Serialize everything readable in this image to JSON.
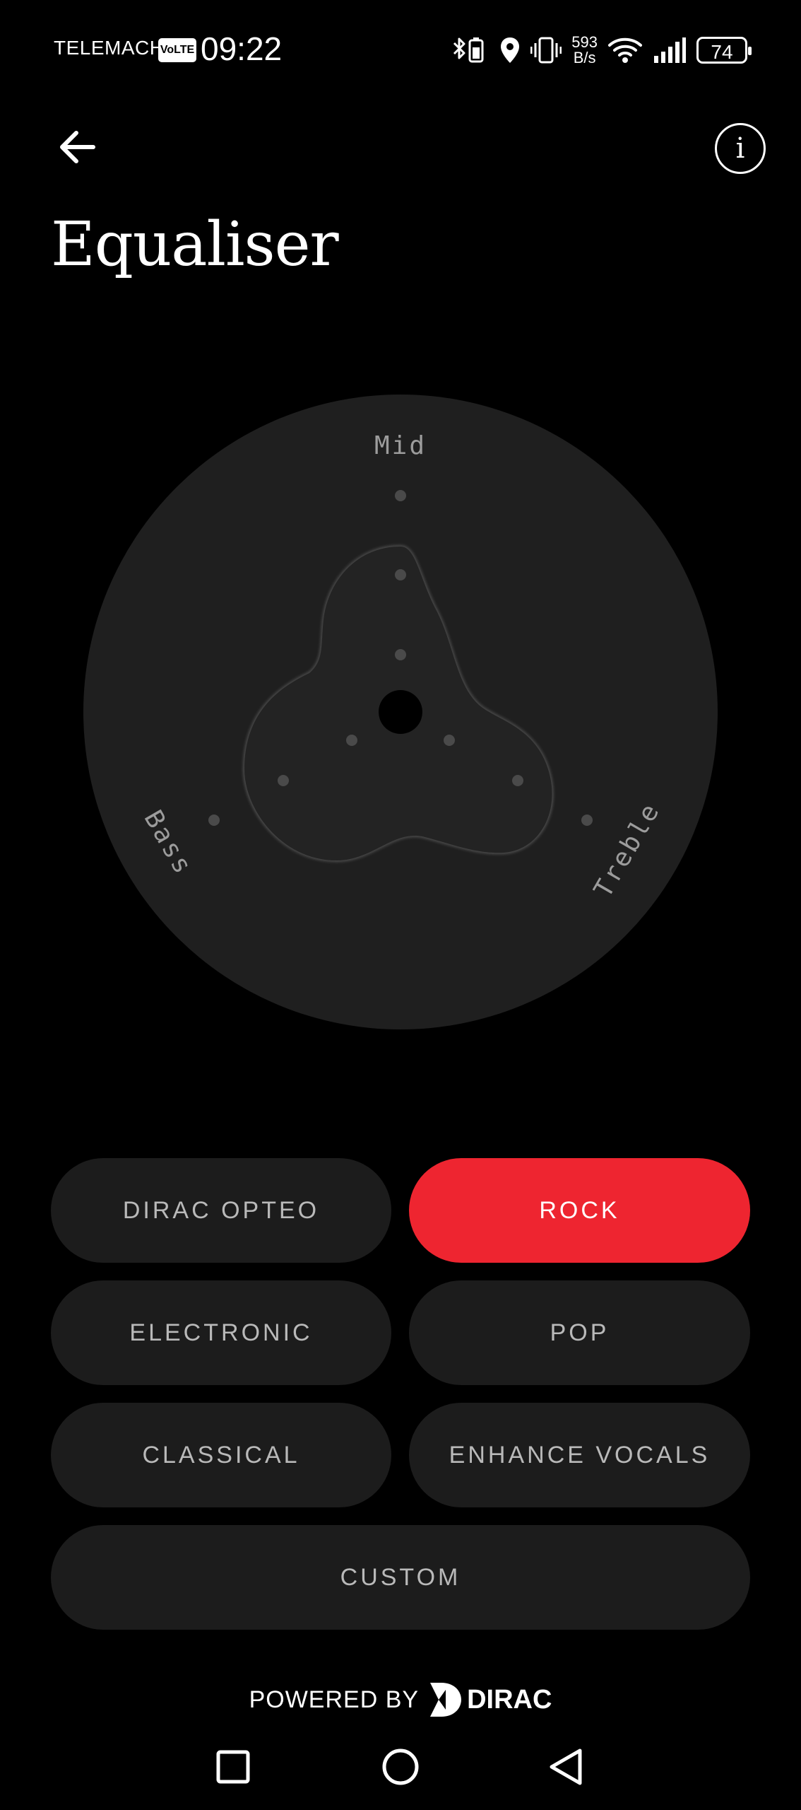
{
  "status_bar": {
    "carrier": "TELEMACH",
    "volte": "VoLTE",
    "time": "09:22",
    "net_speed_value": "593",
    "net_speed_unit": "B/s",
    "battery": "74",
    "icons": [
      "bluetooth-battery-icon",
      "location-icon",
      "vibrate-icon",
      "wifi-icon",
      "signal-icon",
      "battery-icon"
    ]
  },
  "header": {
    "back_icon": "arrow-left-icon",
    "info_icon": "info-icon",
    "info_glyph": "i",
    "title": "Equaliser"
  },
  "dial": {
    "labels": {
      "mid": "Mid",
      "bass": "Bass",
      "treble": "Treble"
    }
  },
  "presets": [
    {
      "label": "DIRAC OPTEO",
      "active": false
    },
    {
      "label": "ROCK",
      "active": true
    },
    {
      "label": "ELECTRONIC",
      "active": false
    },
    {
      "label": "POP",
      "active": false
    },
    {
      "label": "CLASSICAL",
      "active": false
    },
    {
      "label": "ENHANCE VOCALS",
      "active": false
    },
    {
      "label": "CUSTOM",
      "active": false
    }
  ],
  "footer": {
    "powered_by": "POWERED BY",
    "brand": "DIRAC"
  },
  "colors": {
    "accent": "#ee2530",
    "button_bg": "#1c1c1c",
    "dial_bg": "#1f1f1f"
  },
  "navbar": {
    "icons": [
      "recent-apps-icon",
      "home-icon",
      "back-icon"
    ]
  }
}
